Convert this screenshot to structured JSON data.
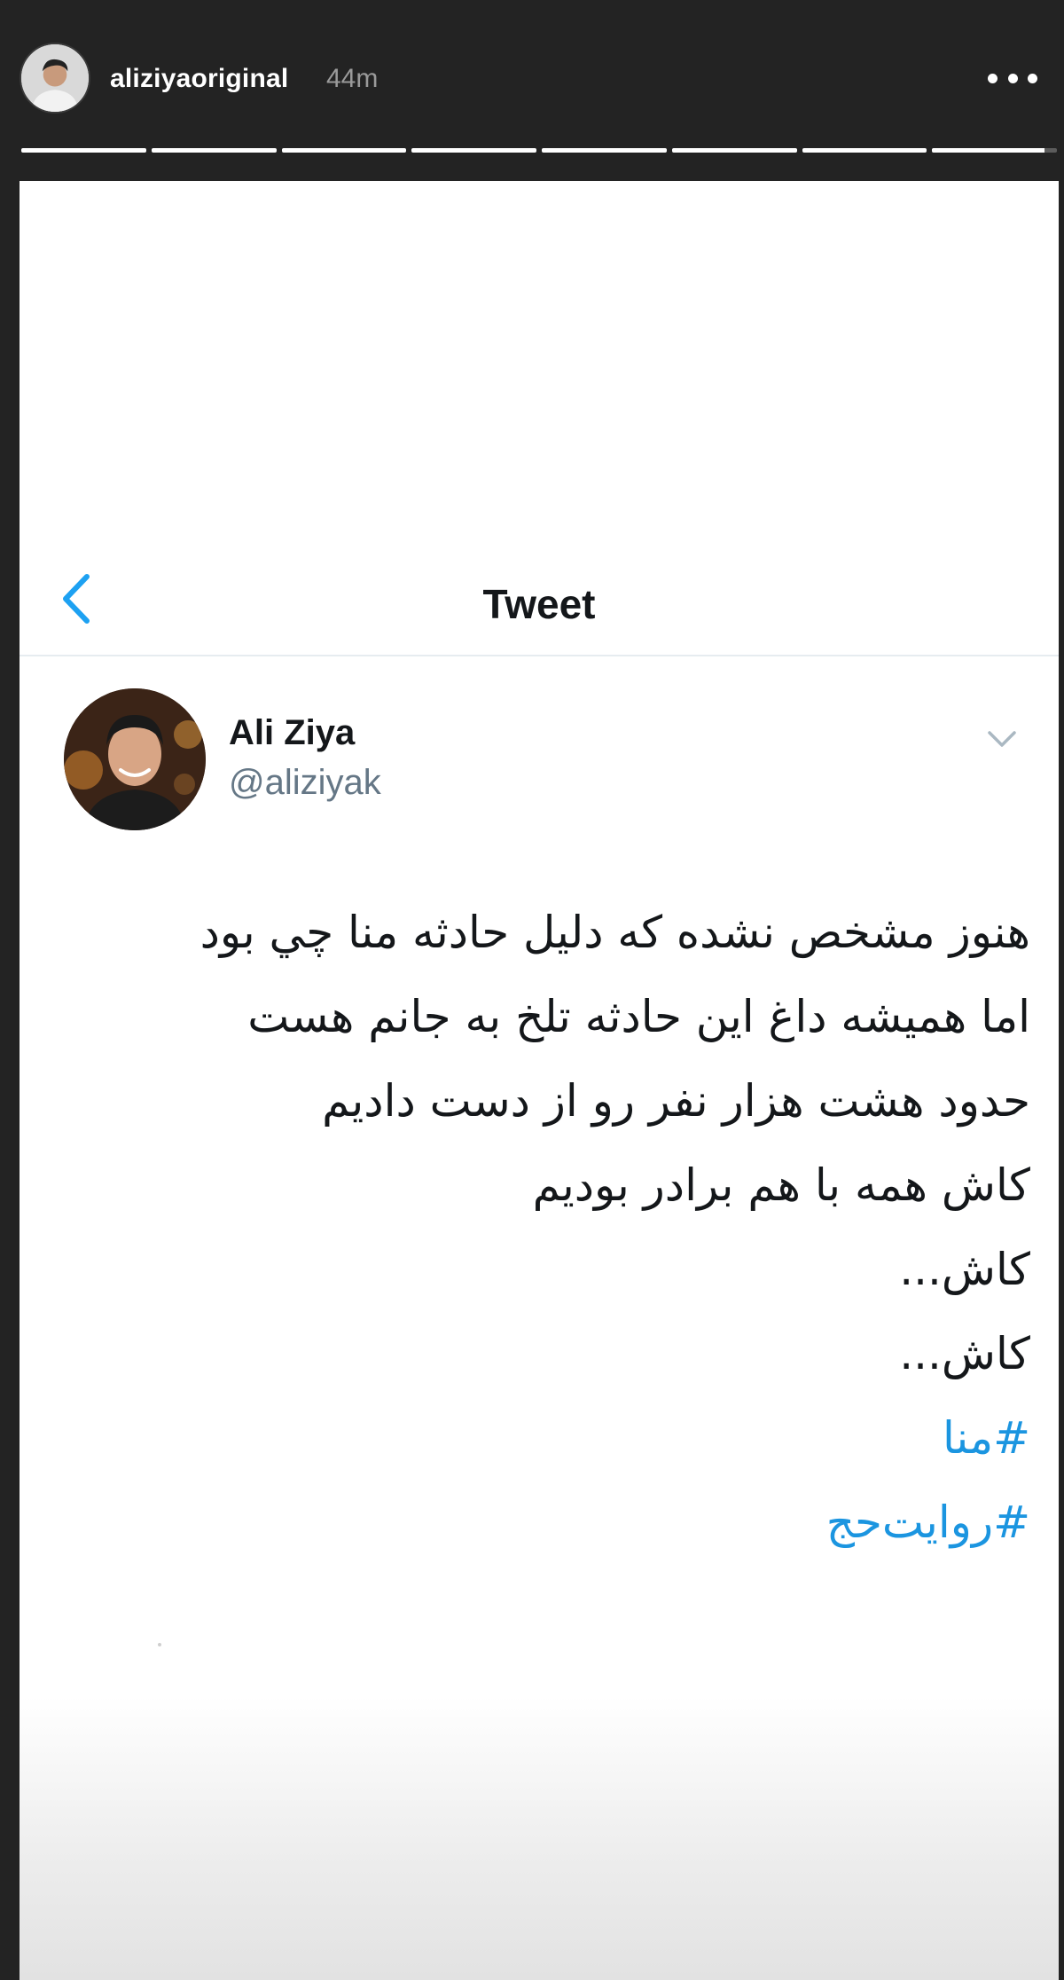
{
  "story": {
    "username": "aliziyaoriginal",
    "time": "44m",
    "segments": [
      1,
      1,
      1,
      1,
      1,
      1,
      1,
      0.9
    ]
  },
  "tweet_screen": {
    "title": "Tweet",
    "author_name": "Ali Ziya",
    "author_handle": "@aliziyak",
    "lines": [
      {
        "text": "هنوز مشخص نشده که دلیل حادثه منا چي بود",
        "link": false
      },
      {
        "text": "اما همیشه داغ این حادثه تلخ به جانم هست",
        "link": false
      },
      {
        "text": "حدود هشت هزار نفر رو از دست دادیم",
        "link": false
      },
      {
        "text": "کاش همه با هم برادر بودیم",
        "link": false
      },
      {
        "text": "کاش...",
        "link": false
      },
      {
        "text": "کاش...",
        "link": false
      },
      {
        "text": "#منا",
        "link": true
      },
      {
        "text": "#روایت‌حج",
        "link": true
      }
    ]
  },
  "colors": {
    "story_bg": "#232323",
    "link": "#1b95e0",
    "handle": "#657786"
  },
  "icons": {
    "back": "chevron-left-icon",
    "menu": "more-horizontal-icon",
    "caret": "chevron-down-icon"
  }
}
